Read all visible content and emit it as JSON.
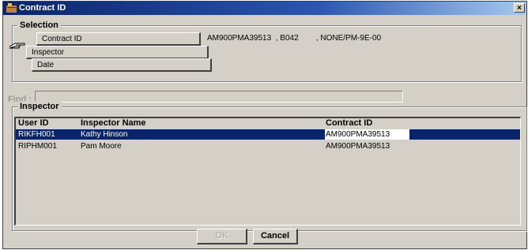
{
  "window": {
    "title": "Contract ID",
    "close_glyph": "×"
  },
  "selection": {
    "legend": "Selection",
    "tabs": [
      {
        "label": "Contract ID",
        "value": "AM900PMA39513  , B042        , NONE/PM-9E-00"
      },
      {
        "label": "Inspector"
      },
      {
        "label": "Date"
      }
    ],
    "pointer_icon": "pointing-hand-icon"
  },
  "find": {
    "label": "Find :",
    "value": ""
  },
  "inspector": {
    "legend": "Inspector",
    "columns": [
      "User ID",
      "Inspector Name",
      "Contract ID"
    ],
    "rows": [
      {
        "user_id": "RIKFH001",
        "name": "Kathy Hinson",
        "contract_id": "AM900PMA39513",
        "selected": true
      },
      {
        "user_id": "RIPHM001",
        "name": "Pam Moore",
        "contract_id": "AM900PMA39513",
        "selected": false
      }
    ]
  },
  "buttons": {
    "ok": "OK",
    "cancel": "Cancel"
  },
  "colors": {
    "face": "#d4d0c8",
    "title_start": "#0a246a",
    "title_end": "#a6caf0",
    "selection": "#0a246a"
  }
}
